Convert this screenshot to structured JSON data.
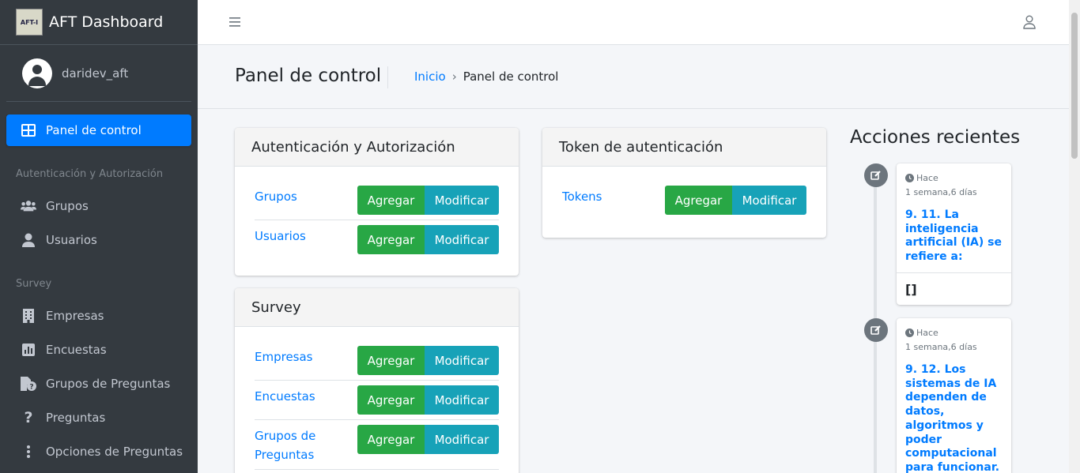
{
  "sidebar": {
    "brand_title": "AFT Dashboard",
    "brand_logo_text": "AFT-I",
    "user_name": "daridev_aft",
    "items": [
      {
        "label": "Panel de control",
        "icon": "dashboard-icon",
        "active": true
      },
      {
        "header": "Autenticación y Autorización"
      },
      {
        "label": "Grupos",
        "icon": "users-icon"
      },
      {
        "label": "Usuarios",
        "icon": "user-icon"
      },
      {
        "header": "Survey"
      },
      {
        "label": "Empresas",
        "icon": "building-icon"
      },
      {
        "label": "Encuestas",
        "icon": "chart-icon"
      },
      {
        "label": "Grupos de Preguntas",
        "icon": "file-question-icon"
      },
      {
        "label": "Preguntas",
        "icon": "question-icon"
      },
      {
        "label": "Opciones de Preguntas",
        "icon": "ellipsis-vertical-icon"
      }
    ]
  },
  "topbar": {
    "menu_icon": "hamburger-icon",
    "user_icon": "user-outline-icon"
  },
  "header": {
    "title": "Panel de control",
    "breadcrumb": {
      "home": "Inicio",
      "separator": "›",
      "current": "Panel de control"
    }
  },
  "apps": [
    {
      "title": "Autenticación y Autorización",
      "models": [
        {
          "name": "Grupos",
          "add": "Agregar",
          "change": "Modificar"
        },
        {
          "name": "Usuarios",
          "add": "Agregar",
          "change": "Modificar"
        }
      ]
    },
    {
      "title": "Token de autenticación",
      "models": [
        {
          "name": "Tokens",
          "add": "Agregar",
          "change": "Modificar"
        }
      ]
    },
    {
      "title": "Survey",
      "models": [
        {
          "name": "Empresas",
          "add": "Agregar",
          "change": "Modificar"
        },
        {
          "name": "Encuestas",
          "add": "Agregar",
          "change": "Modificar"
        },
        {
          "name": "Grupos de Preguntas",
          "add": "Agregar",
          "change": "Modificar"
        }
      ]
    }
  ],
  "recent": {
    "title": "Acciones recientes",
    "items": [
      {
        "prefix": "Hace",
        "date": "1 semana,6 días",
        "text": "9. 11. La inteligencia artificial (IA) se refiere a:",
        "footer": "[]"
      },
      {
        "prefix": "Hace",
        "date": "1 semana,6 días",
        "text": "9. 12. Los sistemas de IA dependen de datos, algoritmos y poder computacional para funcionar."
      }
    ]
  },
  "colors": {
    "primary": "#007bff",
    "success": "#28a745",
    "info": "#17a2b8",
    "sidebar": "#343a40"
  }
}
